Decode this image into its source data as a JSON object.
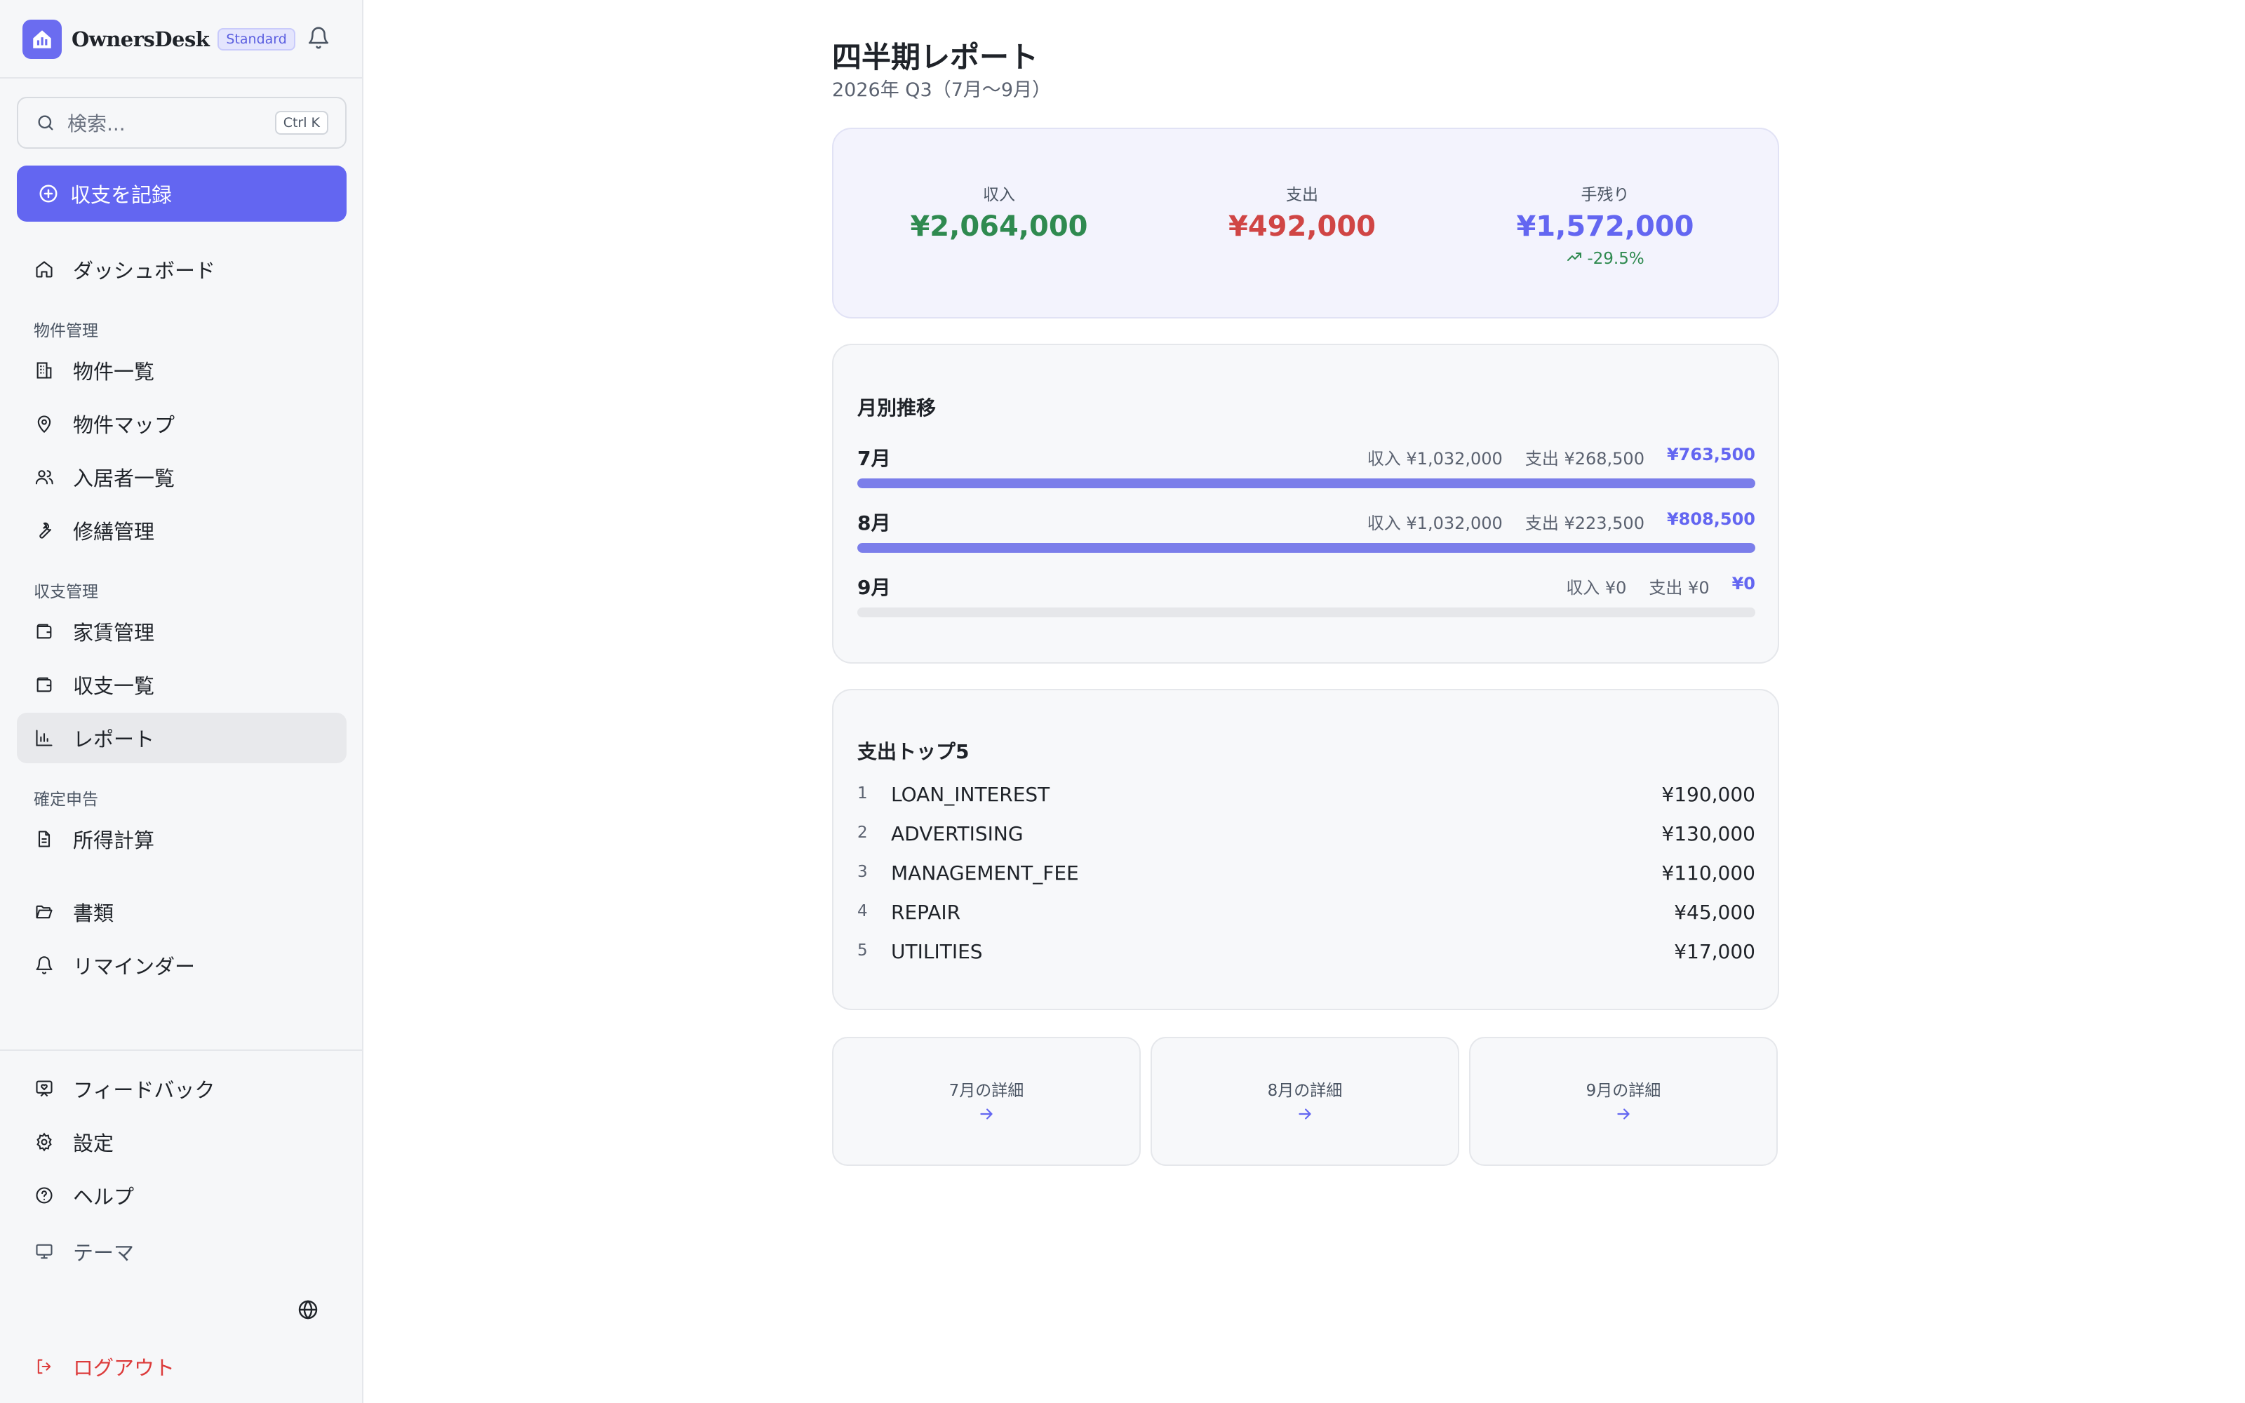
{
  "app": {
    "name": "OwnersDesk",
    "plan": "Standard"
  },
  "search": {
    "placeholder": "検索...",
    "shortcut": "Ctrl K"
  },
  "record_button": "収支を記録",
  "nav": {
    "dashboard": "ダッシュボード",
    "section_property": "物件管理",
    "property_list": "物件一覧",
    "property_map": "物件マップ",
    "tenant_list": "入居者一覧",
    "repair": "修繕管理",
    "section_finance": "収支管理",
    "rent": "家賃管理",
    "finance_list": "収支一覧",
    "report": "レポート",
    "section_tax": "確定申告",
    "income_calc": "所得計算",
    "documents": "書類",
    "reminders": "リマインダー",
    "feedback": "フィードバック",
    "settings": "設定",
    "help": "ヘルプ",
    "theme": "テーマ",
    "logout": "ログアウト"
  },
  "page": {
    "title": "四半期レポート",
    "subtitle": "2026年 Q3（7月〜9月）"
  },
  "summary": {
    "income_label": "収入",
    "income_value": "¥2,064,000",
    "income_color": "#2f8a50",
    "expense_label": "支出",
    "expense_value": "¥492,000",
    "expense_color": "#d04545",
    "net_label": "手残り",
    "net_value": "¥1,572,000",
    "net_color": "#6366f1",
    "net_change": "-29.5%"
  },
  "monthly": {
    "title": "月別推移",
    "months": [
      {
        "name": "7月",
        "income": "収入 ¥1,032,000",
        "expense": "支出 ¥268,500",
        "net": "¥763,500",
        "fill": 1.0
      },
      {
        "name": "8月",
        "income": "収入 ¥1,032,000",
        "expense": "支出 ¥223,500",
        "net": "¥808,500",
        "fill": 1.0
      },
      {
        "name": "9月",
        "income": "収入 ¥0",
        "expense": "支出 ¥0",
        "net": "¥0",
        "fill": 0.0
      }
    ]
  },
  "top5": {
    "title": "支出トップ5",
    "items": [
      {
        "rank": "1",
        "category": "LOAN_INTEREST",
        "amount": "¥190,000"
      },
      {
        "rank": "2",
        "category": "ADVERTISING",
        "amount": "¥130,000"
      },
      {
        "rank": "3",
        "category": "MANAGEMENT_FEE",
        "amount": "¥110,000"
      },
      {
        "rank": "4",
        "category": "REPAIR",
        "amount": "¥45,000"
      },
      {
        "rank": "5",
        "category": "UTILITIES",
        "amount": "¥17,000"
      }
    ]
  },
  "month_links": [
    {
      "label": "7月の詳細"
    },
    {
      "label": "8月の詳細"
    },
    {
      "label": "9月の詳細"
    }
  ]
}
